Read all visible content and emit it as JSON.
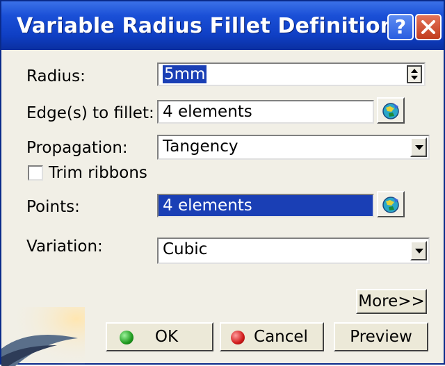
{
  "window": {
    "title": "Variable Radius Fillet Definition",
    "help_label": "?",
    "close_icon": "close-icon"
  },
  "form": {
    "radius_label": "Radius:",
    "radius_value": "5mm",
    "edges_label": "Edge(s) to fillet:",
    "edges_value": "4 elements",
    "propagation_label": "Propagation:",
    "propagation_value": "Tangency",
    "trim_ribbons_label": "Trim ribbons",
    "trim_ribbons_checked": false,
    "points_label": "Points:",
    "points_value": "4 elements",
    "variation_label": "Variation:",
    "variation_value": "Cubic"
  },
  "buttons": {
    "more_label": "More>>",
    "ok_label": "OK",
    "cancel_label": "Cancel",
    "preview_label": "Preview"
  },
  "colors": {
    "titlebar": "#1a4fd6",
    "selection": "#1a3fb5",
    "ok_dot": "#1f9a1f",
    "cancel_dot": "#d01a1a",
    "dialog_bg": "#f1efe6"
  }
}
